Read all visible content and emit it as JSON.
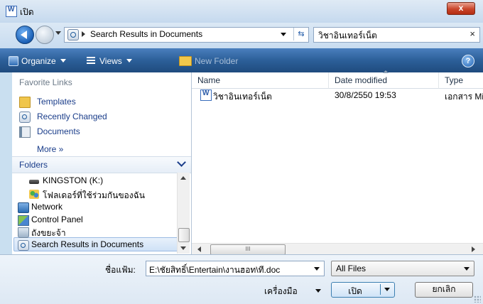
{
  "window": {
    "title": "เปิด",
    "close_label": "x"
  },
  "nav": {
    "address": "Search Results in Documents",
    "search_query": "วิชาอินเทอร์เน็ต",
    "search_clear": "×"
  },
  "toolbar": {
    "organize": "Organize",
    "views": "Views",
    "new_folder": "New Folder",
    "help": "?"
  },
  "sidebar": {
    "favorites_title": "Favorite Links",
    "favorites": [
      {
        "label": "Templates",
        "icon": "folder-icon"
      },
      {
        "label": "Recently Changed",
        "icon": "search-folder-icon"
      },
      {
        "label": "Documents",
        "icon": "documents-icon"
      }
    ],
    "more": "More »",
    "folders_title": "Folders",
    "tree": [
      {
        "label": "KINGSTON (K:)",
        "icon": "drive-icon"
      },
      {
        "label": "โฟลเดอร์ที่ใช้ร่วมกันของฉัน",
        "icon": "shared-folder-icon"
      },
      {
        "label": "Network",
        "icon": "network-icon"
      },
      {
        "label": "Control Panel",
        "icon": "control-panel-icon"
      },
      {
        "label": "ถังขยะจ้า",
        "icon": "recycle-bin-icon"
      },
      {
        "label": "Search Results in Documents",
        "icon": "search-folder-icon"
      }
    ]
  },
  "files": {
    "columns": [
      "Name",
      "Date modified",
      "Type"
    ],
    "rows": [
      {
        "name": "วิชาอินเทอร์เน็ต",
        "date": "30/8/2550 19:53",
        "type": "เอกสาร Mi"
      }
    ],
    "hscroll_grip": "III"
  },
  "footer": {
    "filename_label": "ชื่อแฟ้ม:",
    "filename_value": "E:\\ชัยสิทธิ์\\Entertain\\งานฮอท\\ที.doc",
    "filetype": "All Files",
    "tools": "เครื่องมือ",
    "open": "เปิด",
    "cancel": "ยกเลิก"
  },
  "colors": {
    "toolbar": "#2c5f99",
    "link": "#1a3d8a",
    "frame": "#c9dff0"
  }
}
